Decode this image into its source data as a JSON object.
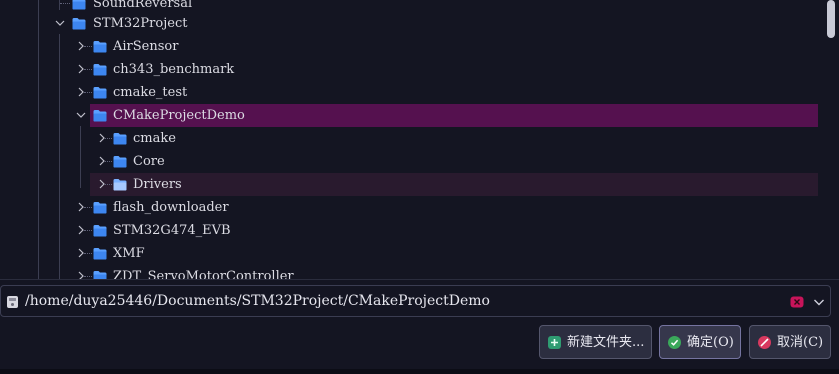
{
  "tree": {
    "items": [
      {
        "label": "SoundReversal"
      },
      {
        "label": "STM32Project"
      },
      {
        "label": "AirSensor"
      },
      {
        "label": "ch343_benchmark"
      },
      {
        "label": "cmake_test"
      },
      {
        "label": "CMakeProjectDemo"
      },
      {
        "label": "cmake"
      },
      {
        "label": "Core"
      },
      {
        "label": "Drivers"
      },
      {
        "label": "flash_downloader"
      },
      {
        "label": "STM32G474_EVB"
      },
      {
        "label": "XMF"
      },
      {
        "label": "ZDT_ServoMotorController"
      }
    ]
  },
  "location": {
    "path": "/home/duya25446/Documents/STM32Project/CMakeProjectDemo"
  },
  "buttons": {
    "new_folder": "新建文件夹...",
    "ok": "确定(O)",
    "cancel": "取消(C)"
  },
  "colors": {
    "selected_row": "#55114f",
    "folder_icon": "#5aa0ff",
    "clear_icon": "#c8145a"
  }
}
